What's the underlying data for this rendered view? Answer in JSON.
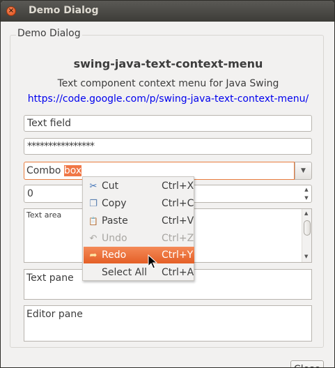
{
  "window": {
    "title": "Demo Dialog",
    "close_glyph": "×"
  },
  "group": {
    "legend": "Demo Dialog"
  },
  "app": {
    "title": "swing-java-text-context-menu",
    "description": "Text component context menu for Java Swing",
    "link": "https://code.google.com/p/swing-java-text-context-menu/"
  },
  "fields": {
    "text_field": "Text field",
    "password_field": "****************",
    "combo_prefix": "Combo ",
    "combo_selected": "box",
    "spinner_value": "0",
    "text_area": "Text area",
    "text_pane": "Text pane",
    "editor_pane": "Editor pane"
  },
  "context_menu": {
    "items": [
      {
        "label": "Cut",
        "shortcut": "Ctrl+X",
        "icon": "scissors-icon",
        "glyph": "✂",
        "enabled": true
      },
      {
        "label": "Copy",
        "shortcut": "Ctrl+C",
        "icon": "copy-icon",
        "glyph": "❐",
        "enabled": true
      },
      {
        "label": "Paste",
        "shortcut": "Ctrl+V",
        "icon": "clipboard-icon",
        "glyph": "📋",
        "enabled": true
      },
      {
        "label": "Undo",
        "shortcut": "Ctrl+Z",
        "icon": "undo-icon",
        "glyph": "↶",
        "enabled": false
      },
      {
        "label": "Redo",
        "shortcut": "Ctrl+Y",
        "icon": "redo-icon",
        "glyph": "➦",
        "enabled": true,
        "highlighted": true
      },
      {
        "label": "Select All",
        "shortcut": "Ctrl+A",
        "icon": "",
        "glyph": "",
        "enabled": true
      }
    ]
  },
  "buttons": {
    "close": "Close"
  },
  "colors": {
    "accent": "#f07746",
    "link": "#0000ee",
    "titlebar": "#3d3c38"
  }
}
